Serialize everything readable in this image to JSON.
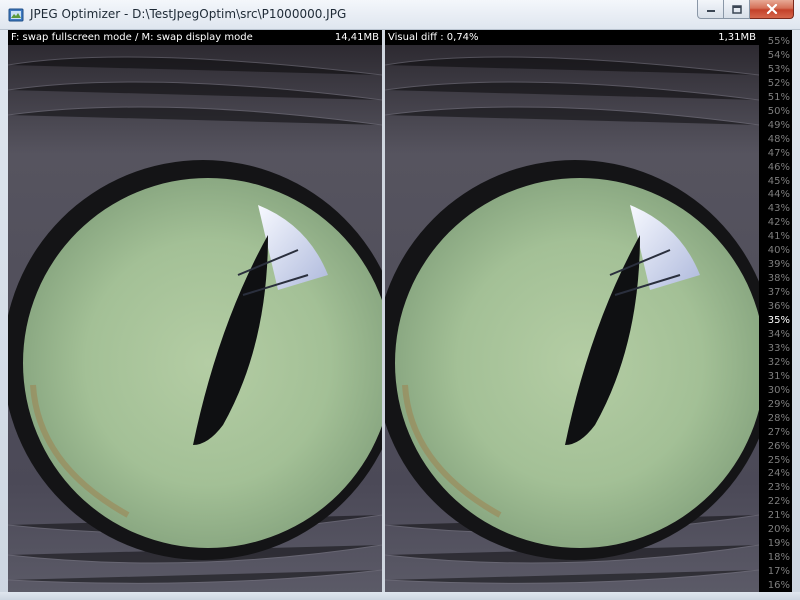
{
  "window": {
    "title": "JPEG Optimizer - D:\\TestJpegOptim\\src\\P1000000.JPG"
  },
  "caption_buttons": {
    "minimize_icon": "minimize-icon",
    "maximize_icon": "maximize-icon",
    "close_icon": "close-icon"
  },
  "left_pane": {
    "hint": "F: swap fullscreen mode / M: swap display mode",
    "size": "14,41MB",
    "image": "cat-eye-original"
  },
  "right_pane": {
    "label": "Visual diff : 0,74%",
    "size": "1,31MB",
    "image": "cat-eye-compressed"
  },
  "quality_scale": {
    "selected": "35%",
    "items": [
      "55%",
      "54%",
      "53%",
      "52%",
      "51%",
      "50%",
      "49%",
      "48%",
      "47%",
      "46%",
      "45%",
      "44%",
      "43%",
      "42%",
      "41%",
      "40%",
      "39%",
      "38%",
      "37%",
      "36%",
      "35%",
      "34%",
      "33%",
      "32%",
      "31%",
      "30%",
      "29%",
      "28%",
      "27%",
      "26%",
      "25%",
      "24%",
      "23%",
      "22%",
      "21%",
      "20%",
      "19%",
      "18%",
      "17%",
      "16%"
    ]
  },
  "colors": {
    "iris": "#a9c39a",
    "fur": "#4a4855",
    "pupil": "#0f1012",
    "scale_text": "#7e7e7e",
    "scale_selected": "#ffffff"
  }
}
